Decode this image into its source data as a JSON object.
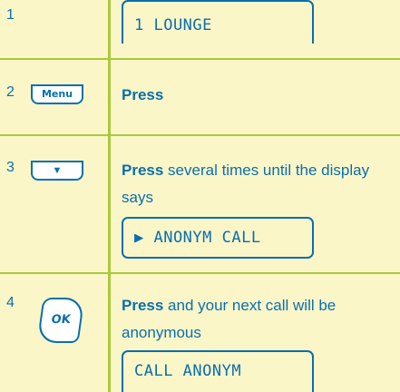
{
  "steps": [
    {
      "number": "1",
      "display": "1 LOUNGE"
    },
    {
      "number": "2",
      "key": "Menu",
      "bold": "Press",
      "text": ""
    },
    {
      "number": "3",
      "key_icon": "▼",
      "bold": "Press",
      "text": " several times until the display says",
      "display": "▶ ANONYM CALL"
    },
    {
      "number": "4",
      "key": "OK",
      "bold": "Press",
      "text": " and your next call will be anonymous",
      "display": "CALL ANONYM"
    }
  ],
  "colors": {
    "text": "#0a6fae",
    "rule": "#a9c93a",
    "background": "#fbf6c8"
  }
}
